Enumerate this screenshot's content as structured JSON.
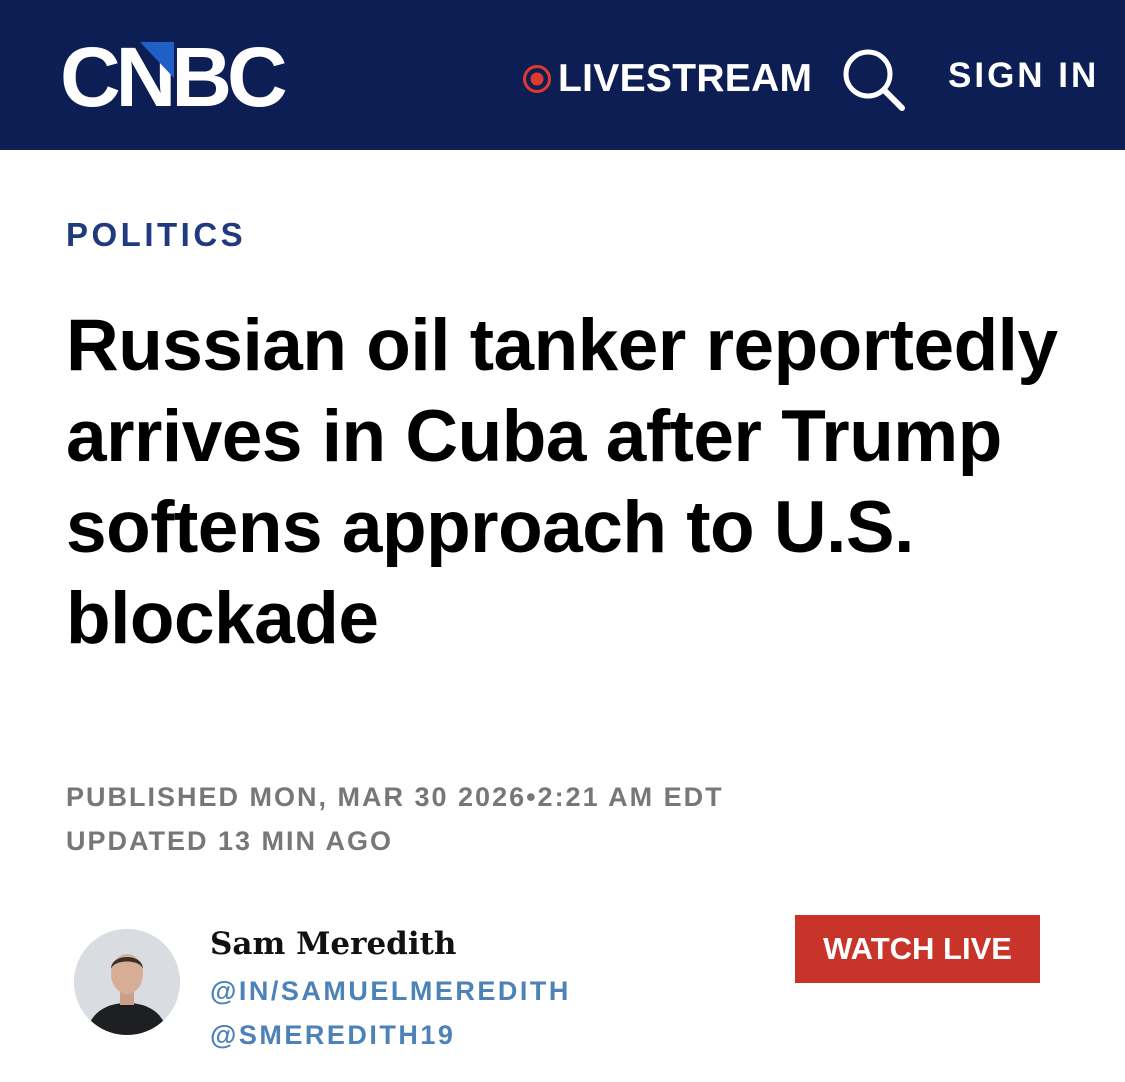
{
  "header": {
    "logo_text": "CNBC",
    "livestream_label": "LIVESTREAM",
    "search_icon": "search-icon",
    "sign_in_label": "SIGN IN",
    "colors": {
      "background": "#0c1e53",
      "live_dot": "#e03a2f"
    }
  },
  "article": {
    "section": "POLITICS",
    "headline": "Russian oil tanker reportedly arrives in Cuba after Trump softens approach to U.S. blockade",
    "published": "PUBLISHED MON, MAR 30 2026•2:21 AM EDT",
    "updated": "UPDATED 13 MIN AGO"
  },
  "author": {
    "name": "Sam Meredith",
    "handle_1": "@IN/SAMUELMEREDITH",
    "handle_2": "@SMEREDITH19"
  },
  "actions": {
    "watch_live_label": "WATCH LIVE",
    "watch_live_color": "#c8332a"
  }
}
